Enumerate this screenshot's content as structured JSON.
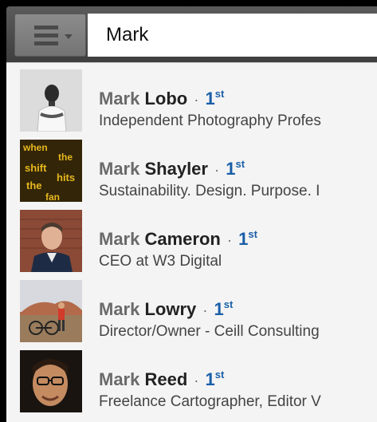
{
  "search": {
    "value": "Mark"
  },
  "results": [
    {
      "first": "Mark",
      "last": "Lobo",
      "degree": "1",
      "degree_suffix": "st",
      "headline": "Independent Photography Profes"
    },
    {
      "first": "Mark",
      "last": "Shayler",
      "degree": "1",
      "degree_suffix": "st",
      "headline": "Sustainability. Design. Purpose. I"
    },
    {
      "first": "Mark",
      "last": "Cameron",
      "degree": "1",
      "degree_suffix": "st",
      "headline": "CEO at W3 Digital"
    },
    {
      "first": "Mark",
      "last": "Lowry",
      "degree": "1",
      "degree_suffix": "st",
      "headline": "Director/Owner - Ceill Consulting"
    },
    {
      "first": "Mark",
      "last": "Reed",
      "degree": "1",
      "degree_suffix": "st",
      "headline": "Freelance Cartographer, Editor V"
    }
  ],
  "avatar_texts": [
    "when",
    "the",
    "shift",
    "hits",
    "the",
    "fan"
  ],
  "colors": {
    "degree": "#1a5fa8"
  }
}
